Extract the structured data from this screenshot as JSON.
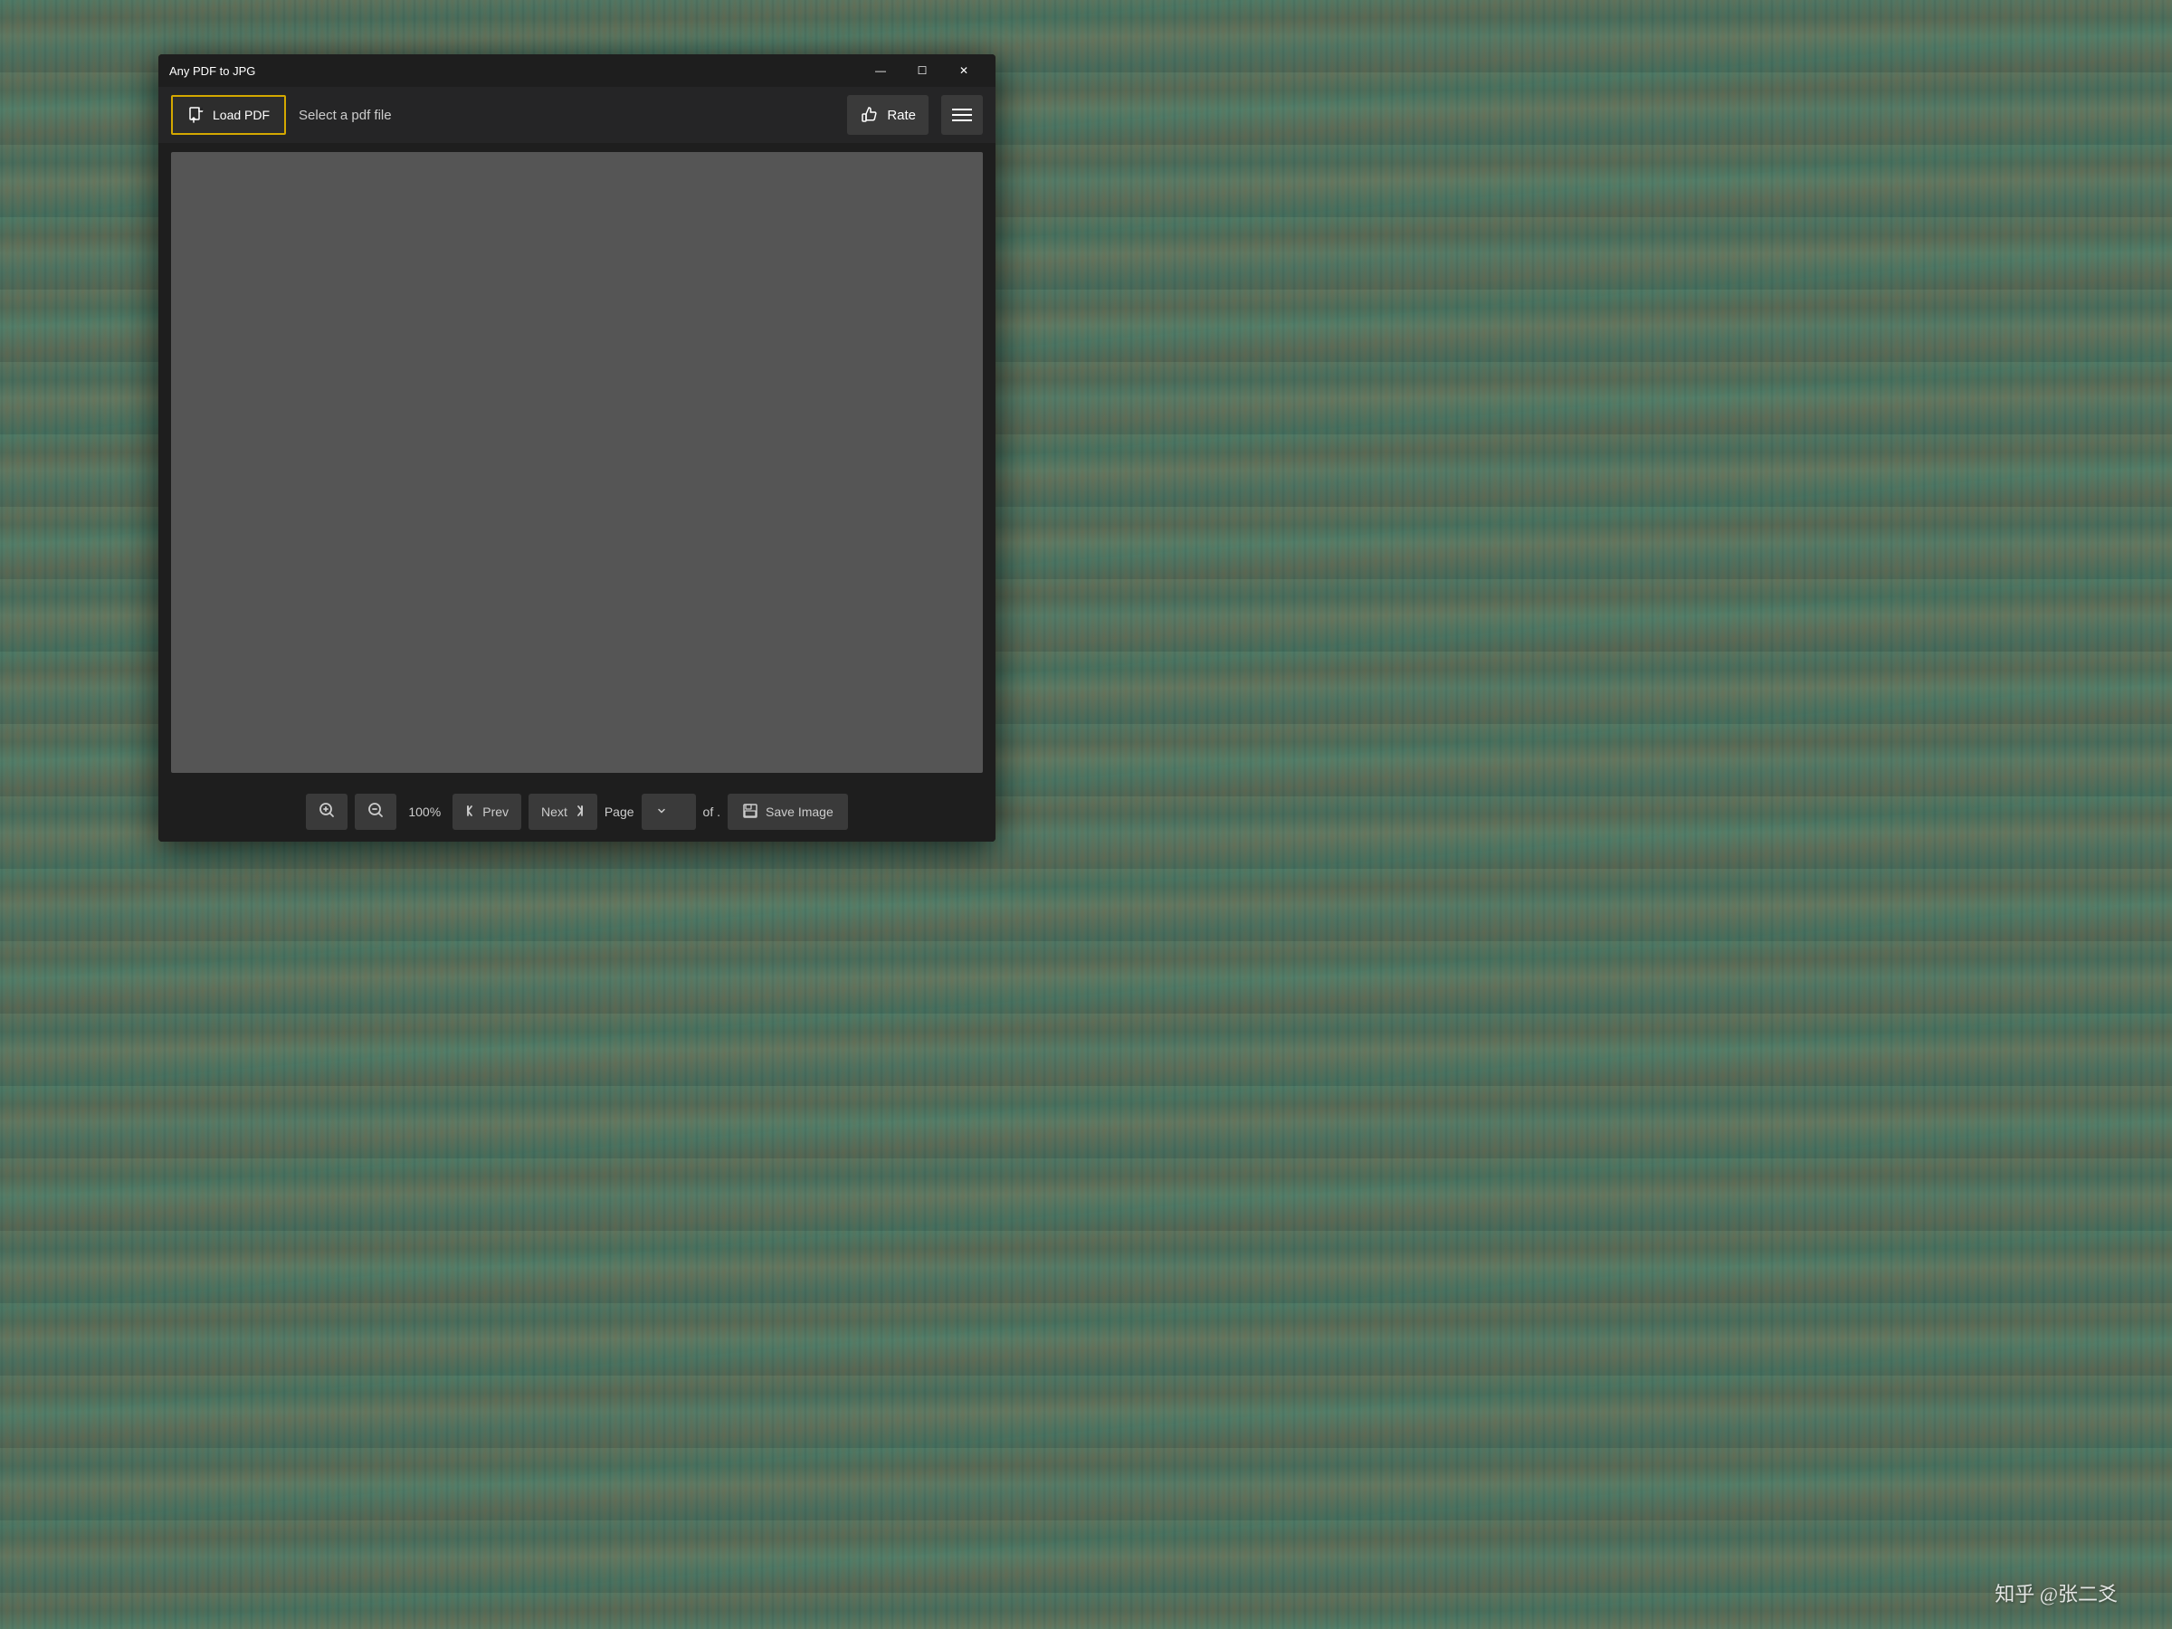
{
  "app": {
    "title": "Any PDF to JPG"
  },
  "window_controls": {
    "minimize": "—",
    "maximize": "☐",
    "close": "✕"
  },
  "toolbar": {
    "load_pdf_label": "Load PDF",
    "select_placeholder": "Select a pdf file",
    "rate_label": "Rate",
    "zoom_percent": "100%"
  },
  "bottom_bar": {
    "prev_label": "Prev",
    "next_label": "Next",
    "page_label": "Page",
    "of_label": "of .",
    "save_label": "Save Image"
  },
  "watermark": {
    "text": "知乎 @张二爻"
  },
  "colors": {
    "accent_border": "#d4a800",
    "window_bg": "#1e1e1e",
    "toolbar_bg": "#252526",
    "button_bg": "#3a3a3a",
    "preview_bg": "#555555",
    "text_primary": "#ffffff",
    "text_secondary": "#cccccc"
  }
}
